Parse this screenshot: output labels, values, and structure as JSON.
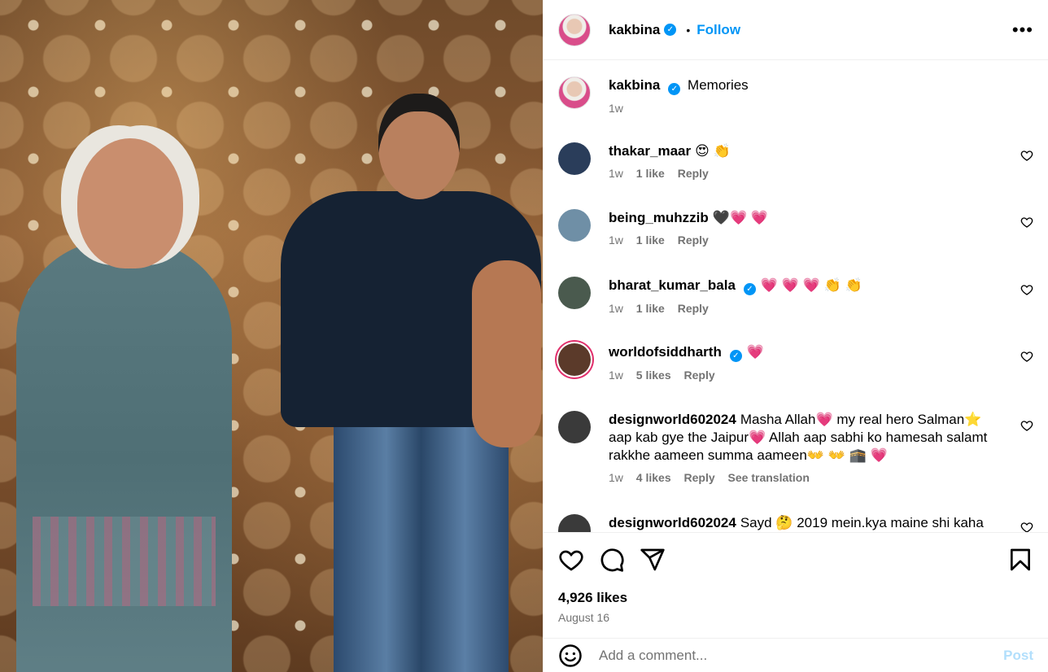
{
  "post": {
    "author": "kakbina",
    "follow_label": "Follow",
    "more_icon": "more-horizontal-icon",
    "verified_icon": "verified-badge-icon"
  },
  "caption": {
    "username": "kakbina",
    "text": "Memories",
    "time": "1w"
  },
  "comments": [
    {
      "username": "thakar_maar",
      "verified": false,
      "text": "😍 👏",
      "time": "1w",
      "likes": "1 like",
      "reply": "Reply",
      "avatar_color": "#2a3d5a"
    },
    {
      "username": "being_muhzzib",
      "verified": false,
      "text": "🖤💗 💗",
      "time": "1w",
      "likes": "1 like",
      "reply": "Reply",
      "avatar_color": "#6f8fa6"
    },
    {
      "username": "bharat_kumar_bala",
      "verified": true,
      "text": "💗 💗 💗 👏 👏",
      "time": "1w",
      "likes": "1 like",
      "reply": "Reply",
      "avatar_color": "#4a5a4e"
    },
    {
      "username": "worldofsiddharth",
      "verified": true,
      "text": "💗",
      "time": "1w",
      "likes": "5 likes",
      "reply": "Reply",
      "avatar_color": "#5b3a2a"
    },
    {
      "username": "designworld602024",
      "verified": false,
      "text": "Masha Allah💗 my real hero Salman⭐ aap kab gye the Jaipur💗 Allah aap sabhi ko hamesah salamt rakkhe aameen summa aameen👐 👐 🕋 💗",
      "time": "1w",
      "likes": "4 likes",
      "reply": "Reply",
      "translate": "See translation",
      "avatar_color": "#3a3a3a"
    },
    {
      "username": "designworld602024",
      "verified": false,
      "text": "Sayd 🤔  2019 mein.kya maine shi kaha",
      "time": "",
      "likes": "",
      "reply": "",
      "avatar_color": "#3a3a3a"
    }
  ],
  "actions": {
    "like_icon": "heart-icon",
    "comment_icon": "comment-icon",
    "share_icon": "share-icon",
    "save_icon": "bookmark-icon",
    "likes": "4,926 likes",
    "date": "August 16"
  },
  "add_comment": {
    "placeholder": "Add a comment...",
    "post_label": "Post",
    "emoji_icon": "emoji-icon"
  },
  "colors": {
    "accent": "#0095f6",
    "muted": "#737373",
    "border": "#efefef",
    "heart": "#ff3b6b"
  }
}
